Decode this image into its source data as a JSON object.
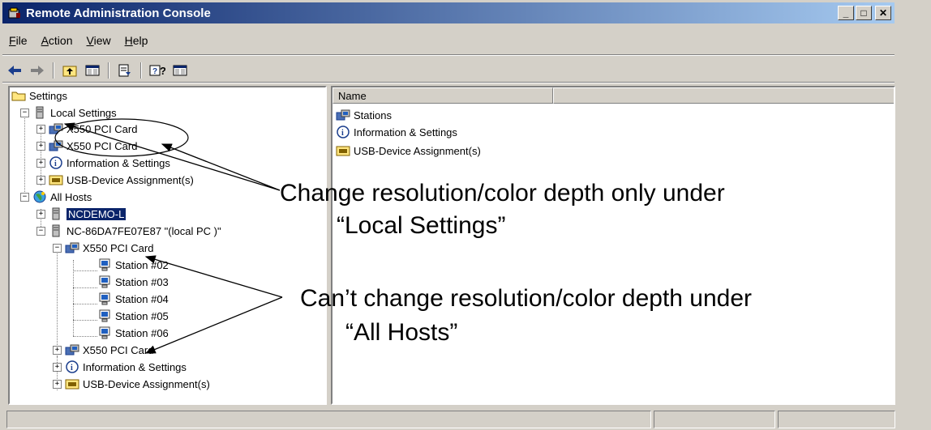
{
  "window": {
    "title": "Remote Administration Console"
  },
  "menubar": {
    "items": [
      {
        "label_pre": "",
        "label_ul": "F",
        "label_post": "ile"
      },
      {
        "label_pre": "",
        "label_ul": "A",
        "label_post": "ction"
      },
      {
        "label_pre": "",
        "label_ul": "V",
        "label_post": "iew"
      },
      {
        "label_pre": "",
        "label_ul": "H",
        "label_post": "elp"
      }
    ]
  },
  "toolbar": {
    "icons": [
      "back-arrow-icon",
      "forward-arrow-icon",
      "up-folder-icon",
      "show-hide-tree-icon",
      "export-list-icon",
      "help-icon",
      "console-tree-icon"
    ]
  },
  "tree": {
    "root": "Settings",
    "local_settings": "Local Settings",
    "local_card1": "X550 PCI Card",
    "local_card2": "X550 PCI Card",
    "local_info": "Information & Settings",
    "local_usb": "USB-Device Assignment(s)",
    "all_hosts": "All Hosts",
    "host1": "NCDEMO-L",
    "host2": "NC-86DA7FE07E87 \"(local PC )\"",
    "host2_card1": "X550 PCI Card",
    "stations": [
      "Station #02",
      "Station #03",
      "Station #04",
      "Station #05",
      "Station #06"
    ],
    "host2_card2": "X550 PCI Card",
    "host2_info": "Information & Settings",
    "host2_usb": "USB-Device Assignment(s)"
  },
  "list": {
    "column_name": "Name",
    "items": [
      "Stations",
      "Information & Settings",
      "USB-Device Assignment(s)"
    ]
  },
  "annotations": {
    "a1_line1": "Change resolution/color depth only under",
    "a1_line2": "“Local Settings”",
    "a2_line1": "Can’t change resolution/color depth under",
    "a2_line2": "“All Hosts”"
  }
}
